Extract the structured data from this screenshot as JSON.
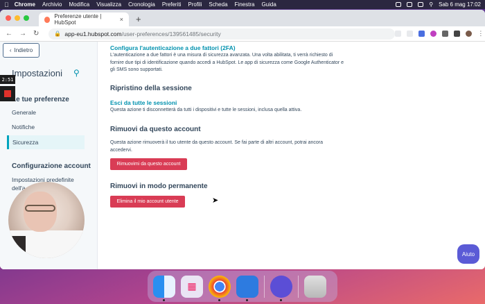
{
  "menubar": {
    "app": "Chrome",
    "items": [
      "Archivio",
      "Modifica",
      "Visualizza",
      "Cronologia",
      "Preferiti",
      "Profili",
      "Scheda",
      "Finestra",
      "Guida"
    ],
    "datetime": "Sab 6 mag  17:02"
  },
  "browser": {
    "tab_title": "Preferenze utente | HubSpot",
    "url_host": "app-eu1.hubspot.com",
    "url_path": "/user-preferences/139561485/security"
  },
  "sidebar": {
    "back_label": "Indietro",
    "title": "Impostazioni",
    "section1": "Le tue preferenze",
    "items": [
      "Generale",
      "Notifiche",
      "Sicurezza"
    ],
    "section2": "Configurazione account",
    "item_partial": "Impostazioni predefinite",
    "item_partial2": "dell'a"
  },
  "content": {
    "twofa_link": "Configura l'autenticazione a due fattori (2FA)",
    "twofa_text": "L'autenticazione a due fattori è una misura di sicurezza avanzata. Una volta abilitata, ti verrà richiesto di fornire due tipi di identificazione quando accedi a HubSpot. Le app di sicurezza come Google Authenticator e gli SMS sono supportati.",
    "session_title": "Ripristino della sessione",
    "session_link": "Esci da tutte le sessioni",
    "session_text": "Questa azione ti disconnetterà da tutti i dispositivi e tutte le sessioni, inclusa quella attiva.",
    "remove_title": "Rimuovi da questo account",
    "remove_text": "Questa azione rimuoverà il tuo utente da questo account. Se fai parte di altri account, potrai ancora accedervi.",
    "remove_button": "Rimuovimi da questo account",
    "delete_title": "Rimuovi in modo permanente",
    "delete_button": "Elimina il mio account utente"
  },
  "help_label": "Aiuto",
  "recording": {
    "timer": "2:51"
  }
}
